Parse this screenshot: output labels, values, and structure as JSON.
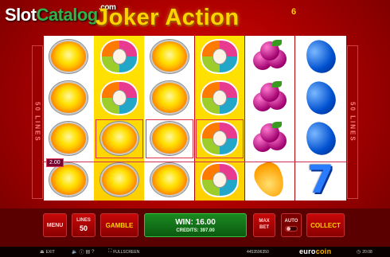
{
  "watermark": {
    "slot": "Slot",
    "catalog": "Catalog",
    "com": ".com"
  },
  "game": {
    "title": "Joker Action",
    "superscript": "6"
  },
  "side_labels": {
    "left": "50 LINES",
    "right": "50 LINES"
  },
  "reels": [
    [
      "sun",
      "sun",
      "sun",
      "sun"
    ],
    [
      "joker",
      "joker",
      "sun",
      "sun"
    ],
    [
      "sun",
      "sun",
      "sun",
      "sun"
    ],
    [
      "joker",
      "joker",
      "joker",
      "joker"
    ],
    [
      "plum",
      "plum",
      "plum",
      "pear"
    ],
    [
      "blue-plum",
      "blue-plum",
      "blue-plum",
      "seven"
    ]
  ],
  "seven_symbol": "7",
  "win_line_value": "2.00",
  "controls": {
    "menu": "MENU",
    "lines_label": "LINES",
    "lines_value": "50",
    "gamble": "GAMBLE",
    "win": "WIN: 16.00",
    "credits": "CREDITS: 397.00",
    "max_bet_1": "MAX",
    "max_bet_2": "BET",
    "auto": "AUTO",
    "collect": "COLLECT"
  },
  "statusbar": {
    "exit": "EXIT",
    "fullscreen": "FULLSCREEN",
    "session_id": "4453596350",
    "time": "20:08",
    "brand_euro": "euro",
    "brand_coin": "coin"
  },
  "colors": {
    "background": "#c00000",
    "title": "#ffd200",
    "win_panel": "#1a8a20",
    "watermark_green": "#2fb34a"
  }
}
